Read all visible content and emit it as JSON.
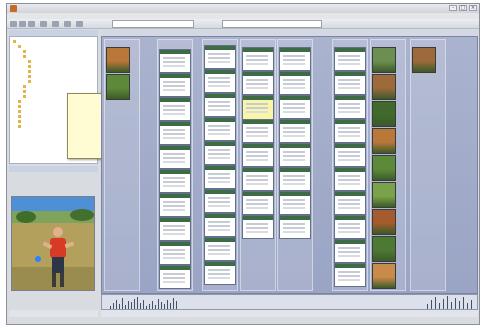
{
  "window": {
    "title": ""
  },
  "tree": {
    "header": "",
    "items": [
      {
        "label": "",
        "depth": 0
      },
      {
        "label": "",
        "depth": 1
      },
      {
        "label": "",
        "depth": 2
      },
      {
        "label": "",
        "depth": 2
      },
      {
        "label": "",
        "depth": 3
      },
      {
        "label": "",
        "depth": 3
      },
      {
        "label": "",
        "depth": 3
      },
      {
        "label": "",
        "depth": 3
      },
      {
        "label": "",
        "depth": 3
      },
      {
        "label": "",
        "depth": 2
      },
      {
        "label": "",
        "depth": 2
      },
      {
        "label": "",
        "depth": 2
      },
      {
        "label": "",
        "depth": 1
      },
      {
        "label": "",
        "depth": 1
      },
      {
        "label": "",
        "depth": 1
      },
      {
        "label": "",
        "depth": 1
      },
      {
        "label": "",
        "depth": 1
      },
      {
        "label": "",
        "depth": 1
      }
    ]
  },
  "tooltip": {
    "lines": [
      "",
      "",
      "",
      ""
    ]
  },
  "preview": {
    "header": "",
    "subject": "golfer-photo"
  },
  "main": {
    "header": ""
  },
  "status": {
    "left": "",
    "right": ""
  },
  "colors": {
    "canvas": "#9aa4c4",
    "tooltip": "#fffbd2",
    "doc_header": "#3d6b45"
  },
  "icons": [
    "app-icon",
    "minimize-icon",
    "maximize-icon",
    "close-icon",
    "back-icon",
    "forward-icon",
    "refresh-icon",
    "home-icon",
    "folder-icon"
  ]
}
